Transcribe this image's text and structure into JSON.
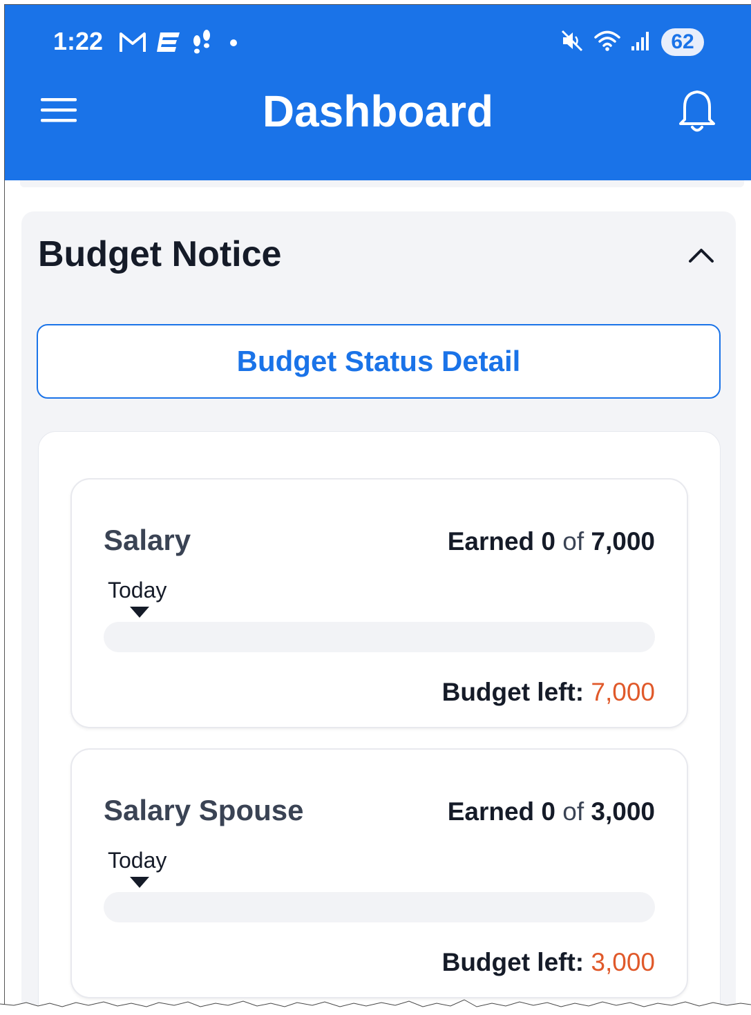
{
  "status_bar": {
    "time": "1:22",
    "battery": "62",
    "icons": [
      "gmail-icon",
      "app-e-icon",
      "footsteps-icon",
      "dot-icon",
      "mute-icon",
      "wifi-icon",
      "signal-icon"
    ]
  },
  "toolbar": {
    "title": "Dashboard",
    "menu_icon": "menu-icon",
    "bell_icon": "bell-icon"
  },
  "colors": {
    "primary": "#1a73e8",
    "section_bg": "#f3f4f7",
    "accent_amount": "#e0592a",
    "text_dark": "#151b28"
  },
  "budget_notice": {
    "title": "Budget Notice",
    "collapse_icon": "chevron-up-icon",
    "detail_button": "Budget Status Detail",
    "items": [
      {
        "name": "Salary",
        "earned_label": "Earned",
        "earned": "0",
        "of_label": "of",
        "total": "7,000",
        "today_label": "Today",
        "progress_fraction": 0,
        "budget_left_label": "Budget left:",
        "budget_left": "7,000"
      },
      {
        "name": "Salary Spouse",
        "earned_label": "Earned",
        "earned": "0",
        "of_label": "of",
        "total": "3,000",
        "today_label": "Today",
        "progress_fraction": 0,
        "budget_left_label": "Budget left:",
        "budget_left": "3,000"
      }
    ]
  }
}
